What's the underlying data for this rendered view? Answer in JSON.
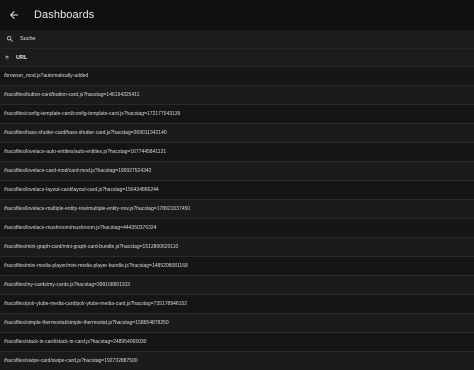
{
  "header": {
    "title": "Dashboards"
  },
  "search": {
    "placeholder": "Suche"
  },
  "table": {
    "sort_column_label": "URL",
    "rows": [
      "/browser_mod.js?automatically-added",
      "/hacsfiles/button-card/button-card.js?hacstag=146194325411",
      "/hacsfiles/config-template-card/config-template-card.js?hacstag=172177543136",
      "/hacsfiles/hass-shutter-card/hass-shutter-card.js?hacstag=269011342140",
      "/hacsfiles/lovelace-auto-entities/auto-entities.js?hacstag=1677445841131",
      "/hacsfiles/lovelace-card-mod/card-mod.js?hacstag=190927524342",
      "/hacsfiles/lovelace-layout-card/layout-card.js?hacstag=156434866244",
      "/hacsfiles/lovelace-multiple-entity-row/multiple-entity-row.js?hacstag=178921037450",
      "/hacsfiles/lovelace-mushroom/mushroom.js?hacstag=444350376324",
      "/hacsfiles/mini-graph-card/mini-graph-card-bundle.js?hacstag=1512800620110",
      "/hacsfiles/mini-media-player/mini-media-player-bundle.js?hacstag=1485208081168",
      "/hacsfiles/my-cards/my-cards.js?hacstag=399108901103",
      "/hacsfiles/polr-ytube-media-card/polr-ytube-media-card.js?hacstag=735178946152",
      "/hacsfiles/simple-thermostat/simple-thermostat.js?hacstag=158654878250",
      "/hacsfiles/stack-in-card/stack-in-card.js?hacstag=248954065030",
      "/hacsfiles/swipe-card/swipe-card.js?hacstag=192732887500"
    ]
  },
  "colors": {
    "background": "#111111",
    "row": "#151515",
    "row_alt": "#1b1b1b",
    "text": "#e1e1e1"
  },
  "icons": {
    "back": "arrow-left-icon",
    "search": "search-icon",
    "sort": "arrow-up-icon"
  }
}
